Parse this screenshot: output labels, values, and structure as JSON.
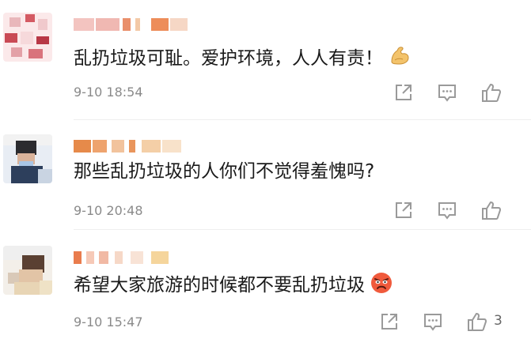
{
  "comments": [
    {
      "text": "乱扔垃圾可耻。爱护环境，人人有责！",
      "emoji": "flexed-biceps-emoji",
      "time": "9-10 18:54",
      "like_count": ""
    },
    {
      "text": "那些乱扔垃圾的人你们不觉得羞愧吗?",
      "emoji": "",
      "time": "9-10 20:48",
      "like_count": ""
    },
    {
      "text": "希望大家旅游的时候都不要乱扔垃圾",
      "emoji": "angry-face-emoji",
      "time": "9-10 15:47",
      "like_count": "3"
    }
  ],
  "icons": {
    "share": "share-icon",
    "comment": "comment-icon",
    "like": "thumbs-up-icon"
  },
  "colors": {
    "text": "#1a1a1a",
    "meta": "#8a8a8a",
    "icon": "#9a9a9a",
    "divider": "#eeeeee"
  }
}
